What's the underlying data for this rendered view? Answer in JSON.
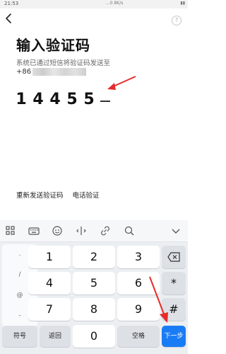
{
  "status_bar": {
    "time": "21:53",
    "network_text": "...0.8K/s"
  },
  "header": {
    "help_label": "?"
  },
  "main": {
    "title": "输入验证码",
    "subtitle": "系统已通过短信将验证码发送至",
    "phone_prefix": "+86",
    "code_digits": [
      "1",
      "4",
      "4",
      "5",
      "5"
    ],
    "resend_label": "重新发送验证码",
    "voice_label": "电话验证"
  },
  "keyboard": {
    "toolbar_icons": [
      "grid-icon",
      "keyboard-icon",
      "emoji-icon",
      "cursor-icon",
      "link-icon",
      "search-icon",
      "collapse-icon"
    ],
    "symbol_keys": [
      ".",
      "/",
      "@",
      "-"
    ],
    "number_keys": [
      "1",
      "2",
      "3",
      "4",
      "5",
      "6",
      "7",
      "8",
      "9",
      "0"
    ],
    "backspace_icon": "backspace-icon",
    "star_key": "*",
    "hash_key": "#",
    "symbols_label": "符号",
    "return_label": "返回",
    "space_label": "空格",
    "next_label": "下一步"
  },
  "colors": {
    "accent": "#1a7cf5",
    "arrow": "#e52b2b",
    "keyboard_bg": "#eceff2"
  }
}
